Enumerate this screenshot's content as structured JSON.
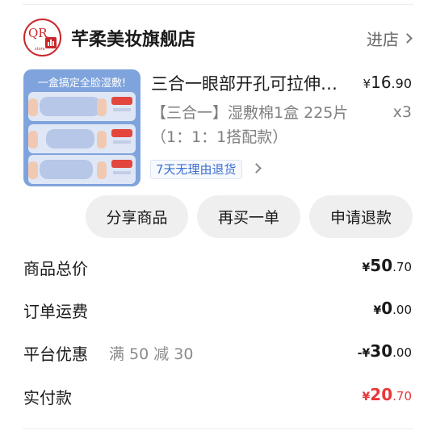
{
  "store": {
    "logo_text": "QR",
    "logo_sub": "store",
    "name": "芊柔美妆旗舰店",
    "enter_label": "进店"
  },
  "product": {
    "thumb_banner": "一盒搞定全脸湿敷!",
    "title": "三合一眼部开孔可拉伸湿敷棉",
    "price_currency": "¥",
    "price_int": "16",
    "price_dec": ".90",
    "spec": "【三合一】湿敷棉1盒 225片（1：1：1搭配款）",
    "quantity": "x3",
    "service_badge": "7天无理由退货"
  },
  "actions": {
    "share": "分享商品",
    "rebuy": "再买一单",
    "refund": "申请退款"
  },
  "summary": {
    "goods_total_label": "商品总价",
    "goods_total_cur": "¥",
    "goods_total_int": "50",
    "goods_total_dec": ".70",
    "shipping_label": "订单运费",
    "shipping_cur": "¥",
    "shipping_int": "0",
    "shipping_dec": ".00",
    "discount_label": "平台优惠",
    "discount_note": "满 50 减 30",
    "discount_cur": "-¥",
    "discount_int": "30",
    "discount_dec": ".00",
    "paid_label": "实付款",
    "paid_cur": "¥",
    "paid_int": "20",
    "paid_dec": ".70"
  },
  "colors": {
    "accent_red": "#e8373a",
    "brand_red": "#c9272b",
    "badge_blue": "#3d6fd1",
    "button_bg": "#efefef"
  },
  "icons": [
    "store-logo",
    "chevron-right-icon"
  ]
}
